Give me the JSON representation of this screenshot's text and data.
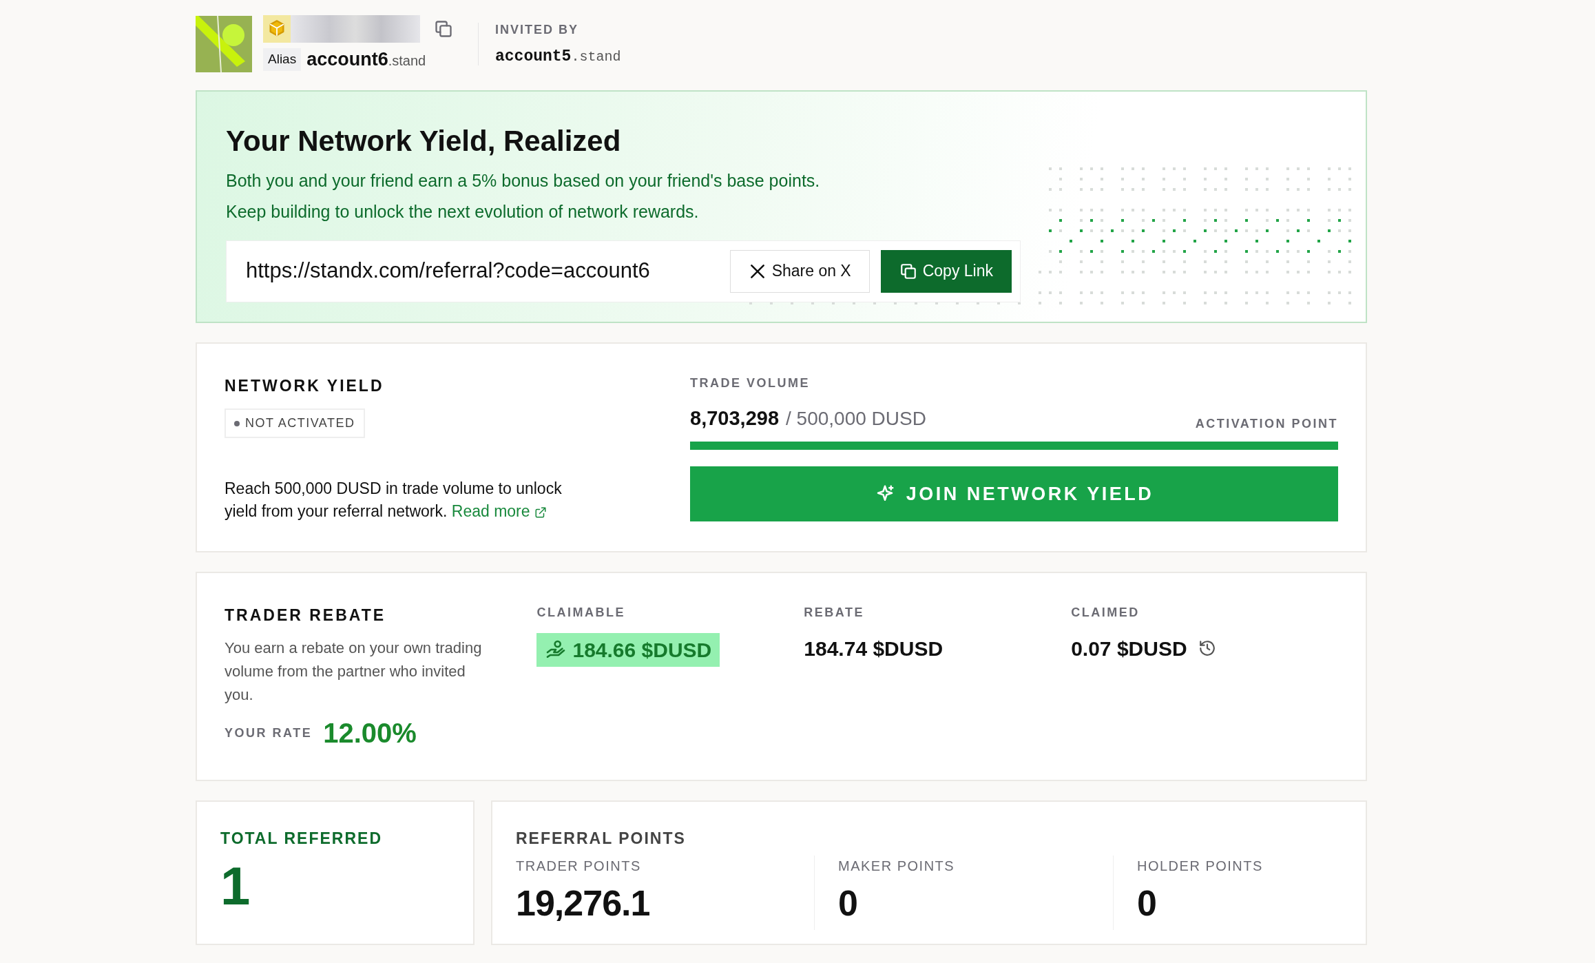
{
  "header": {
    "alias_label": "Alias",
    "alias_name": "account6",
    "alias_suffix": ".stand",
    "invited_by_label": "INVITED BY",
    "invited_by_name": "account5",
    "invited_by_suffix": ".stand"
  },
  "banner": {
    "title": "Your Network Yield, Realized",
    "lines": [
      "Both you and your friend earn a 5% bonus based on your friend's base points.",
      "Keep building to unlock the next evolution of network rewards."
    ],
    "referral_link": "https://standx.com/referral?code=account6",
    "share_button": "Share on X",
    "copy_button": "Copy Link"
  },
  "network_yield": {
    "title": "NETWORK YIELD",
    "status": "NOT ACTIVATED",
    "activated": false,
    "description": "Reach 500,000 DUSD in trade volume to unlock yield from your referral network.",
    "read_more": "Read more",
    "volume_label": "TRADE VOLUME",
    "volume": "8,703,298",
    "target": "/ 500,000 DUSD",
    "activation_label": "ACTIVATION POINT",
    "level": 1,
    "join_button": "JOIN NETWORK YIELD"
  },
  "trader_rebate": {
    "title": "TRADER REBATE",
    "description": "You earn a rebate on your own trading volume from the partner who invited you.",
    "rate_label": "YOUR RATE",
    "rate": "12.00%",
    "stats": [
      {
        "kind": "claimable",
        "label": "CLAIMABLE",
        "value": "184.66 $DUSD"
      },
      {
        "kind": "plain",
        "label": "REBATE",
        "value": "184.74 $DUSD"
      },
      {
        "kind": "history",
        "label": "CLAIMED",
        "value": "0.07 $DUSD"
      }
    ]
  },
  "referrals": {
    "total_label": "TOTAL REFERRED",
    "total": "1",
    "points_title": "REFERRAL POINTS",
    "points": [
      {
        "label": "TRADER POINTS",
        "value": "19,276.1"
      },
      {
        "label": "MAKER POINTS",
        "value": "0"
      },
      {
        "label": "HOLDER POINTS",
        "value": "0"
      }
    ]
  }
}
